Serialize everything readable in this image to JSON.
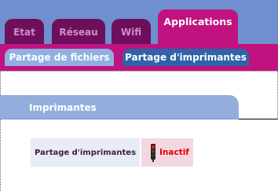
{
  "main_tabs": [
    {
      "label": "Etat",
      "active": false
    },
    {
      "label": "Réseau",
      "active": false
    },
    {
      "label": "Wifi",
      "active": false
    },
    {
      "label": "Applications",
      "active": true
    }
  ],
  "sub_tabs": [
    {
      "label": "Partage de fichiers",
      "active": false
    },
    {
      "label": "Partage d'imprimantes",
      "active": true
    }
  ],
  "section": {
    "title": "Imprimantes"
  },
  "printer_row": {
    "label": "Partage d'imprimantes",
    "status": "Inactif",
    "status_icon": "traffic-light-red-icon"
  },
  "colors": {
    "main_tab_inactive": "#6e0f5c",
    "main_tab_active": "#c0137f",
    "sub_tab_active": "#2f63a8",
    "sub_tab_inactive": "#8fb0e0",
    "header_bg": "#6f8fcf",
    "status_red": "#e10000"
  }
}
